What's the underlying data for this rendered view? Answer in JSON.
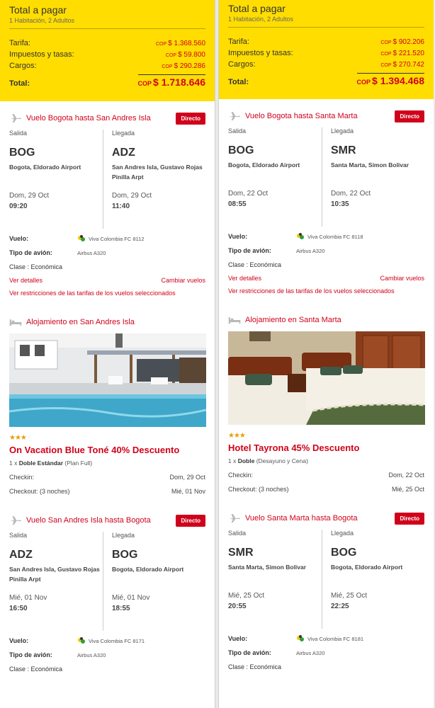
{
  "packages": [
    {
      "total": {
        "title": "Total a pagar",
        "subtitle": "1 Habitación, 2 Adultos",
        "rows": [
          {
            "label": "Tarifa:",
            "currency": "COP",
            "amount": "$ 1.368.560"
          },
          {
            "label": "Impuestos y tasas:",
            "currency": "COP",
            "amount": "$ 59.800"
          },
          {
            "label": "Cargos:",
            "currency": "COP",
            "amount": "$ 290.286"
          }
        ],
        "grand_label": "Total:",
        "grand_currency": "COP",
        "grand_amount": "$ 1.718.646"
      },
      "outbound": {
        "title": "Vuelo Bogota hasta San Andres Isla",
        "badge": "Directo",
        "dep_label": "Salida",
        "arr_label": "Llegada",
        "dep_code": "BOG",
        "dep_city": "Bogota, Eldorado Airport",
        "dep_date": "Dom, 29 Oct",
        "dep_time": "09:20",
        "arr_code": "ADZ",
        "arr_city": "San Andres Isla, Gustavo Rojas Pinilla Arpt",
        "arr_date": "Dom, 29 Oct",
        "arr_time": "11:40",
        "flight_label": "Vuelo:",
        "flight_value": "Viva Colombia FC 8112",
        "plane_label": "Tipo de avión:",
        "plane_value": "Airbus A320",
        "class_text": "Clase : Económica",
        "details_link": "Ver detalles",
        "change_link": "Cambiar vuelos",
        "restrictions_link": "Ver restricciones de las tarifas de los vuelos seleccionados"
      },
      "hotel": {
        "title": "Alojamiento en San Andres Isla",
        "stars": "★★★",
        "name": "On Vacation Blue Toné 40% Descuento",
        "room_qty": "1 x ",
        "room_type": "Doble Estándar",
        "room_plan": " (Plan Full)",
        "checkin_label": "Checkin:",
        "checkin_date": "Dom, 29 Oct",
        "checkout_label": "Checkout: (3 noches)",
        "checkout_date": "Mié, 01 Nov"
      },
      "return": {
        "title": "Vuelo San Andres Isla hasta Bogota",
        "badge": "Directo",
        "dep_label": "Salida",
        "arr_label": "Llegada",
        "dep_code": "ADZ",
        "dep_city": "San Andres Isla, Gustavo Rojas Pinilla Arpt",
        "dep_date": "Mié, 01 Nov",
        "dep_time": "16:50",
        "arr_code": "BOG",
        "arr_city": "Bogota, Eldorado Airport",
        "arr_date": "Mié, 01 Nov",
        "arr_time": "18:55",
        "flight_label": "Vuelo:",
        "flight_value": "Viva Colombia FC 8171",
        "plane_label": "Tipo de avión:",
        "plane_value": "Airbus A320",
        "class_text": "Clase : Económica"
      }
    },
    {
      "total": {
        "title": "Total a pagar",
        "subtitle": "1 Habitación, 2 Adultos",
        "rows": [
          {
            "label": "Tarifa:",
            "currency": "COP",
            "amount": "$ 902.206"
          },
          {
            "label": "Impuestos y tasas:",
            "currency": "COP",
            "amount": "$ 221.520"
          },
          {
            "label": "Cargos:",
            "currency": "COP",
            "amount": "$ 270.742"
          }
        ],
        "grand_label": "Total:",
        "grand_currency": "COP",
        "grand_amount": "$ 1.394.468"
      },
      "outbound": {
        "title": "Vuelo Bogota hasta Santa Marta",
        "badge": "Directo",
        "dep_label": "Salida",
        "arr_label": "Llegada",
        "dep_code": "BOG",
        "dep_city": "Bogota, Eldorado Airport",
        "dep_date": "Dom, 22 Oct",
        "dep_time": "08:55",
        "arr_code": "SMR",
        "arr_city": "Santa Marta, Simon Bolivar",
        "arr_date": "Dom, 22 Oct",
        "arr_time": "10:35",
        "flight_label": "Vuelo:",
        "flight_value": "Viva Colombia FC 8118",
        "plane_label": "Tipo de avión:",
        "plane_value": "Airbus A320",
        "class_text": "Clase : Económica",
        "details_link": "Ver detalles",
        "change_link": "Cambiar vuelos",
        "restrictions_link": "Ver restricciones de las tarifas de los vuelos seleccionados"
      },
      "hotel": {
        "title": "Alojamiento en Santa Marta",
        "stars": "★★★",
        "name": "Hotel Tayrona 45% Descuento",
        "room_qty": "1 x ",
        "room_type": "Doble",
        "room_plan": " (Desayuno y Cena)",
        "checkin_label": "Checkin:",
        "checkin_date": "Dom, 22 Oct",
        "checkout_label": "Checkout: (3 noches)",
        "checkout_date": "Mié, 25 Oct"
      },
      "return": {
        "title": "Vuelo Santa Marta hasta Bogota",
        "badge": "Directo",
        "dep_label": "Salida",
        "arr_label": "Llegada",
        "dep_code": "SMR",
        "dep_city": "Santa Marta, Simon Bolivar",
        "dep_date": "Mié, 25 Oct",
        "dep_time": "20:55",
        "arr_code": "BOG",
        "arr_city": "Bogota, Eldorado Airport",
        "arr_date": "Mié, 25 Oct",
        "arr_time": "22:25",
        "flight_label": "Vuelo:",
        "flight_value": "Viva Colombia FC 8181",
        "plane_label": "Tipo de avión:",
        "plane_value": "Airbus A320",
        "class_text": "Clase : Económica"
      }
    }
  ],
  "colors": {
    "accent": "#d0021b",
    "total_bg": "#ffdd00",
    "stars": "#e5a100"
  },
  "icons": {
    "flight": "airplane-icon",
    "hotel": "bed-icon",
    "airline": "viva-colombia-logo"
  }
}
